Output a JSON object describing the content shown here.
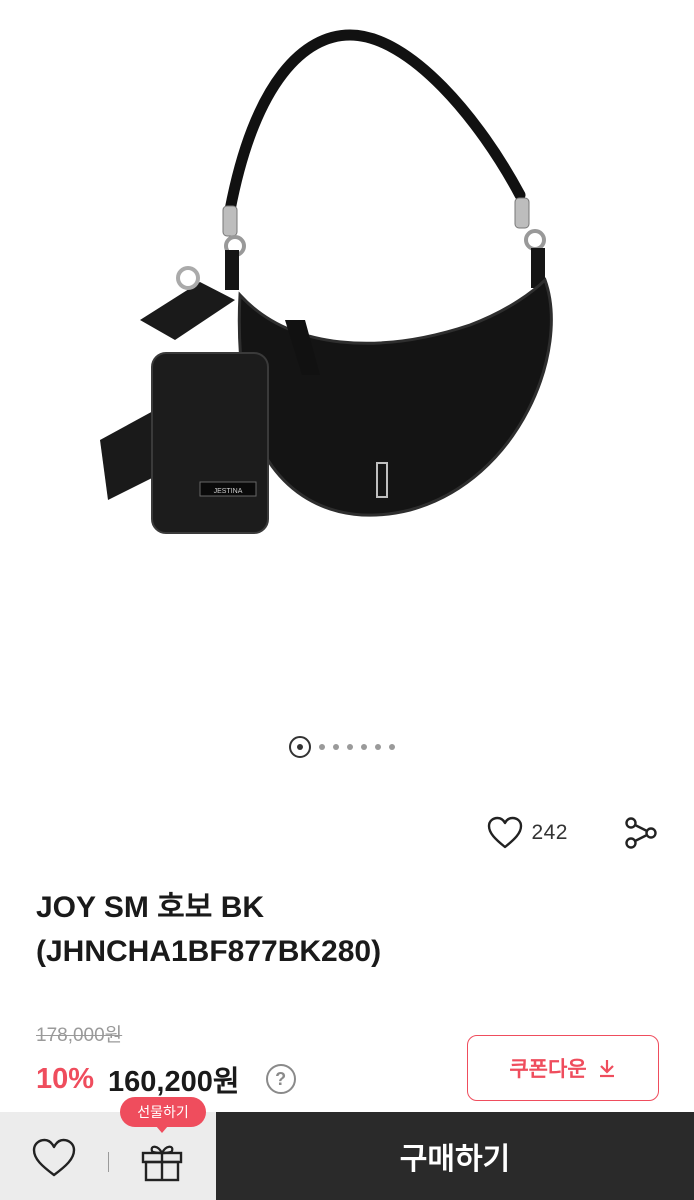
{
  "gallery": {
    "image_label": "JESTINA",
    "pagination": {
      "active_index": 0,
      "total": 7
    }
  },
  "actions": {
    "like_count": "242",
    "icons": {
      "like": "heart-icon",
      "share": "share-icon"
    }
  },
  "product": {
    "title_line1": "JOY SM 호보 BK",
    "title_line2": "(JHNCHA1BF877BK280)"
  },
  "price": {
    "original": "178,000원",
    "discount": "10%",
    "current": "160,200원",
    "help": "?"
  },
  "coupon": {
    "label": "쿠폰다운"
  },
  "bottom_bar": {
    "gift_tooltip": "선물하기",
    "buy_label": "구매하기",
    "icons": {
      "wishlist": "heart-icon",
      "gift": "gift-icon"
    }
  },
  "colors": {
    "accent": "#ef4d5d",
    "dark_bar": "#2a2a2a",
    "light_bar": "#ececec"
  }
}
